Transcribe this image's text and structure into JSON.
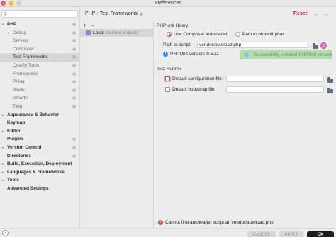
{
  "window": {
    "title": "Preferences"
  },
  "sidebar": {
    "search_placeholder": "",
    "items": [
      {
        "label": "PHP",
        "level": 0,
        "expanded": true,
        "config": true
      },
      {
        "label": "Debug",
        "level": 1,
        "expandable": true,
        "config": true
      },
      {
        "label": "Servers",
        "level": 1,
        "config": true
      },
      {
        "label": "Composer",
        "level": 1,
        "config": true
      },
      {
        "label": "Test Frameworks",
        "level": 1,
        "selected": true,
        "config": true
      },
      {
        "label": "Quality Tools",
        "level": 1,
        "config": true
      },
      {
        "label": "Frameworks",
        "level": 1,
        "config": true
      },
      {
        "label": "Phing",
        "level": 1,
        "config": true
      },
      {
        "label": "Blade",
        "level": 1,
        "config": true
      },
      {
        "label": "Smarty",
        "level": 1,
        "config": true
      },
      {
        "label": "Twig",
        "level": 1,
        "config": true
      },
      {
        "label": "Appearance & Behavior",
        "level": 0,
        "expandable": true
      },
      {
        "label": "Keymap",
        "level": 0
      },
      {
        "label": "Editor",
        "level": 0,
        "expandable": true
      },
      {
        "label": "Plugins",
        "level": 0,
        "config": true
      },
      {
        "label": "Version Control",
        "level": 0,
        "expandable": true,
        "config": true
      },
      {
        "label": "Directories",
        "level": 0,
        "config": true
      },
      {
        "label": "Build, Execution, Deployment",
        "level": 0,
        "expandable": true
      },
      {
        "label": "Languages & Frameworks",
        "level": 0,
        "expandable": true
      },
      {
        "label": "Tools",
        "level": 0,
        "expandable": true
      },
      {
        "label": "Advanced Settings",
        "level": 0
      }
    ]
  },
  "header": {
    "crumb_parent": "PHP",
    "crumb_separator": "›",
    "crumb_current": "Test Frameworks",
    "reset_label": "Reset",
    "back_icon": "←",
    "forward_icon": "→"
  },
  "interpreters": {
    "add_icon": "+",
    "remove_icon": "−",
    "item_label": "Local",
    "item_sub": "(current project)"
  },
  "phpunit": {
    "section_title": "PHPUnit library",
    "option_composer": "Use Composer autoloader",
    "option_phar": "Path to phpunit.phar",
    "path_label": "Path to script:",
    "path_value": "vendor/autoload.php",
    "version_text": "PHPUnit version: 9.5.11",
    "toast_text": "Successfully updated PHPUnit version"
  },
  "test_runner": {
    "section_title": "Test Runner",
    "default_config_label": "Default configuration file:",
    "default_config_value": "",
    "default_bootstrap_label": "Default bootstrap file:",
    "default_bootstrap_value": ""
  },
  "error": {
    "icon": "!",
    "text": "Cannot find autoloader script at 'vendor/autoload.php'"
  },
  "footer": {
    "help_label": "?",
    "cancel_label": "CANCEL",
    "apply_label": "APPLY",
    "ok_label": "OK"
  },
  "colors": {
    "accent": "#b14a8a",
    "reset": "#c2185b",
    "toast_bg": "#b7dcb0",
    "error_icon": "#e0453a",
    "ok_button": "#1c1c1c"
  }
}
